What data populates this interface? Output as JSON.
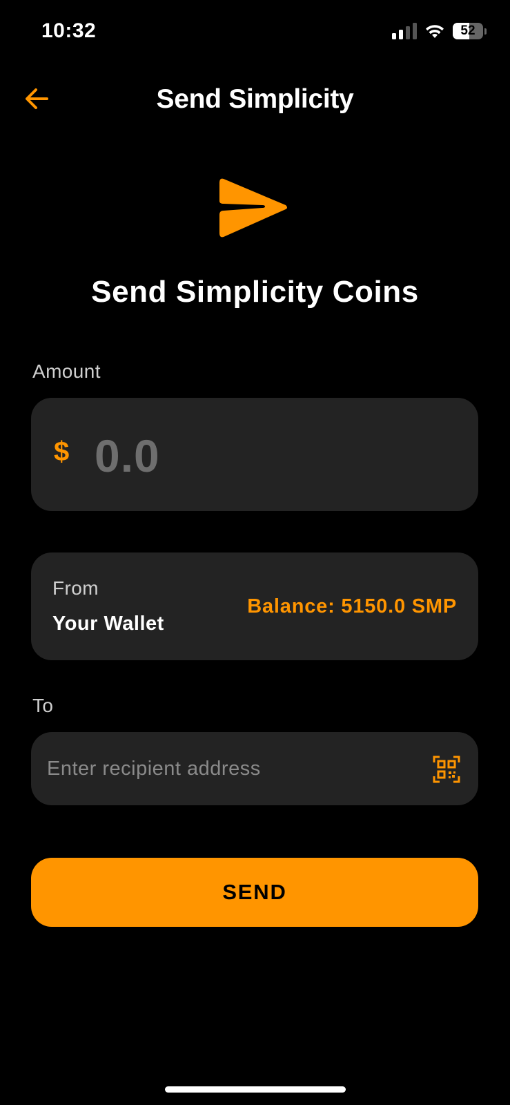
{
  "status_bar": {
    "time": "10:32",
    "battery_level": "52",
    "icons": [
      "cellular-signal-icon",
      "wifi-icon",
      "battery-icon"
    ]
  },
  "header": {
    "title": "Send Simplicity",
    "back_icon": "arrow-left-icon"
  },
  "hero": {
    "icon": "send-arrow-icon",
    "title": "Send Simplicity Coins"
  },
  "amount": {
    "label": "Amount",
    "currency_symbol": "$",
    "value": "0.0"
  },
  "from": {
    "label": "From",
    "value": "Your Wallet",
    "balance": "Balance: 5150.0 SMP"
  },
  "to": {
    "label": "To",
    "placeholder": "Enter recipient address",
    "value": "",
    "scan_icon": "qr-scan-icon"
  },
  "actions": {
    "send_label": "SEND"
  },
  "colors": {
    "accent": "#ff9500",
    "background": "#000000",
    "card": "#232323",
    "muted_text": "#6e6e6e"
  }
}
